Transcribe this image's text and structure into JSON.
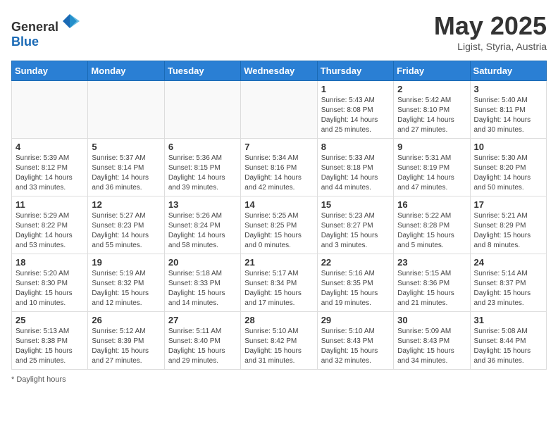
{
  "header": {
    "logo_general": "General",
    "logo_blue": "Blue",
    "main_title": "May 2025",
    "subtitle": "Ligist, Styria, Austria"
  },
  "days_of_week": [
    "Sunday",
    "Monday",
    "Tuesday",
    "Wednesday",
    "Thursday",
    "Friday",
    "Saturday"
  ],
  "weeks": [
    [
      {
        "day": "",
        "sunrise": "",
        "sunset": "",
        "daylight": ""
      },
      {
        "day": "",
        "sunrise": "",
        "sunset": "",
        "daylight": ""
      },
      {
        "day": "",
        "sunrise": "",
        "sunset": "",
        "daylight": ""
      },
      {
        "day": "",
        "sunrise": "",
        "sunset": "",
        "daylight": ""
      },
      {
        "day": "1",
        "sunrise": "Sunrise: 5:43 AM",
        "sunset": "Sunset: 8:08 PM",
        "daylight": "Daylight: 14 hours and 25 minutes."
      },
      {
        "day": "2",
        "sunrise": "Sunrise: 5:42 AM",
        "sunset": "Sunset: 8:10 PM",
        "daylight": "Daylight: 14 hours and 27 minutes."
      },
      {
        "day": "3",
        "sunrise": "Sunrise: 5:40 AM",
        "sunset": "Sunset: 8:11 PM",
        "daylight": "Daylight: 14 hours and 30 minutes."
      }
    ],
    [
      {
        "day": "4",
        "sunrise": "Sunrise: 5:39 AM",
        "sunset": "Sunset: 8:12 PM",
        "daylight": "Daylight: 14 hours and 33 minutes."
      },
      {
        "day": "5",
        "sunrise": "Sunrise: 5:37 AM",
        "sunset": "Sunset: 8:14 PM",
        "daylight": "Daylight: 14 hours and 36 minutes."
      },
      {
        "day": "6",
        "sunrise": "Sunrise: 5:36 AM",
        "sunset": "Sunset: 8:15 PM",
        "daylight": "Daylight: 14 hours and 39 minutes."
      },
      {
        "day": "7",
        "sunrise": "Sunrise: 5:34 AM",
        "sunset": "Sunset: 8:16 PM",
        "daylight": "Daylight: 14 hours and 42 minutes."
      },
      {
        "day": "8",
        "sunrise": "Sunrise: 5:33 AM",
        "sunset": "Sunset: 8:18 PM",
        "daylight": "Daylight: 14 hours and 44 minutes."
      },
      {
        "day": "9",
        "sunrise": "Sunrise: 5:31 AM",
        "sunset": "Sunset: 8:19 PM",
        "daylight": "Daylight: 14 hours and 47 minutes."
      },
      {
        "day": "10",
        "sunrise": "Sunrise: 5:30 AM",
        "sunset": "Sunset: 8:20 PM",
        "daylight": "Daylight: 14 hours and 50 minutes."
      }
    ],
    [
      {
        "day": "11",
        "sunrise": "Sunrise: 5:29 AM",
        "sunset": "Sunset: 8:22 PM",
        "daylight": "Daylight: 14 hours and 53 minutes."
      },
      {
        "day": "12",
        "sunrise": "Sunrise: 5:27 AM",
        "sunset": "Sunset: 8:23 PM",
        "daylight": "Daylight: 14 hours and 55 minutes."
      },
      {
        "day": "13",
        "sunrise": "Sunrise: 5:26 AM",
        "sunset": "Sunset: 8:24 PM",
        "daylight": "Daylight: 14 hours and 58 minutes."
      },
      {
        "day": "14",
        "sunrise": "Sunrise: 5:25 AM",
        "sunset": "Sunset: 8:25 PM",
        "daylight": "Daylight: 15 hours and 0 minutes."
      },
      {
        "day": "15",
        "sunrise": "Sunrise: 5:23 AM",
        "sunset": "Sunset: 8:27 PM",
        "daylight": "Daylight: 15 hours and 3 minutes."
      },
      {
        "day": "16",
        "sunrise": "Sunrise: 5:22 AM",
        "sunset": "Sunset: 8:28 PM",
        "daylight": "Daylight: 15 hours and 5 minutes."
      },
      {
        "day": "17",
        "sunrise": "Sunrise: 5:21 AM",
        "sunset": "Sunset: 8:29 PM",
        "daylight": "Daylight: 15 hours and 8 minutes."
      }
    ],
    [
      {
        "day": "18",
        "sunrise": "Sunrise: 5:20 AM",
        "sunset": "Sunset: 8:30 PM",
        "daylight": "Daylight: 15 hours and 10 minutes."
      },
      {
        "day": "19",
        "sunrise": "Sunrise: 5:19 AM",
        "sunset": "Sunset: 8:32 PM",
        "daylight": "Daylight: 15 hours and 12 minutes."
      },
      {
        "day": "20",
        "sunrise": "Sunrise: 5:18 AM",
        "sunset": "Sunset: 8:33 PM",
        "daylight": "Daylight: 15 hours and 14 minutes."
      },
      {
        "day": "21",
        "sunrise": "Sunrise: 5:17 AM",
        "sunset": "Sunset: 8:34 PM",
        "daylight": "Daylight: 15 hours and 17 minutes."
      },
      {
        "day": "22",
        "sunrise": "Sunrise: 5:16 AM",
        "sunset": "Sunset: 8:35 PM",
        "daylight": "Daylight: 15 hours and 19 minutes."
      },
      {
        "day": "23",
        "sunrise": "Sunrise: 5:15 AM",
        "sunset": "Sunset: 8:36 PM",
        "daylight": "Daylight: 15 hours and 21 minutes."
      },
      {
        "day": "24",
        "sunrise": "Sunrise: 5:14 AM",
        "sunset": "Sunset: 8:37 PM",
        "daylight": "Daylight: 15 hours and 23 minutes."
      }
    ],
    [
      {
        "day": "25",
        "sunrise": "Sunrise: 5:13 AM",
        "sunset": "Sunset: 8:38 PM",
        "daylight": "Daylight: 15 hours and 25 minutes."
      },
      {
        "day": "26",
        "sunrise": "Sunrise: 5:12 AM",
        "sunset": "Sunset: 8:39 PM",
        "daylight": "Daylight: 15 hours and 27 minutes."
      },
      {
        "day": "27",
        "sunrise": "Sunrise: 5:11 AM",
        "sunset": "Sunset: 8:40 PM",
        "daylight": "Daylight: 15 hours and 29 minutes."
      },
      {
        "day": "28",
        "sunrise": "Sunrise: 5:10 AM",
        "sunset": "Sunset: 8:42 PM",
        "daylight": "Daylight: 15 hours and 31 minutes."
      },
      {
        "day": "29",
        "sunrise": "Sunrise: 5:10 AM",
        "sunset": "Sunset: 8:43 PM",
        "daylight": "Daylight: 15 hours and 32 minutes."
      },
      {
        "day": "30",
        "sunrise": "Sunrise: 5:09 AM",
        "sunset": "Sunset: 8:43 PM",
        "daylight": "Daylight: 15 hours and 34 minutes."
      },
      {
        "day": "31",
        "sunrise": "Sunrise: 5:08 AM",
        "sunset": "Sunset: 8:44 PM",
        "daylight": "Daylight: 15 hours and 36 minutes."
      }
    ]
  ],
  "footer": {
    "note": "Daylight hours"
  }
}
